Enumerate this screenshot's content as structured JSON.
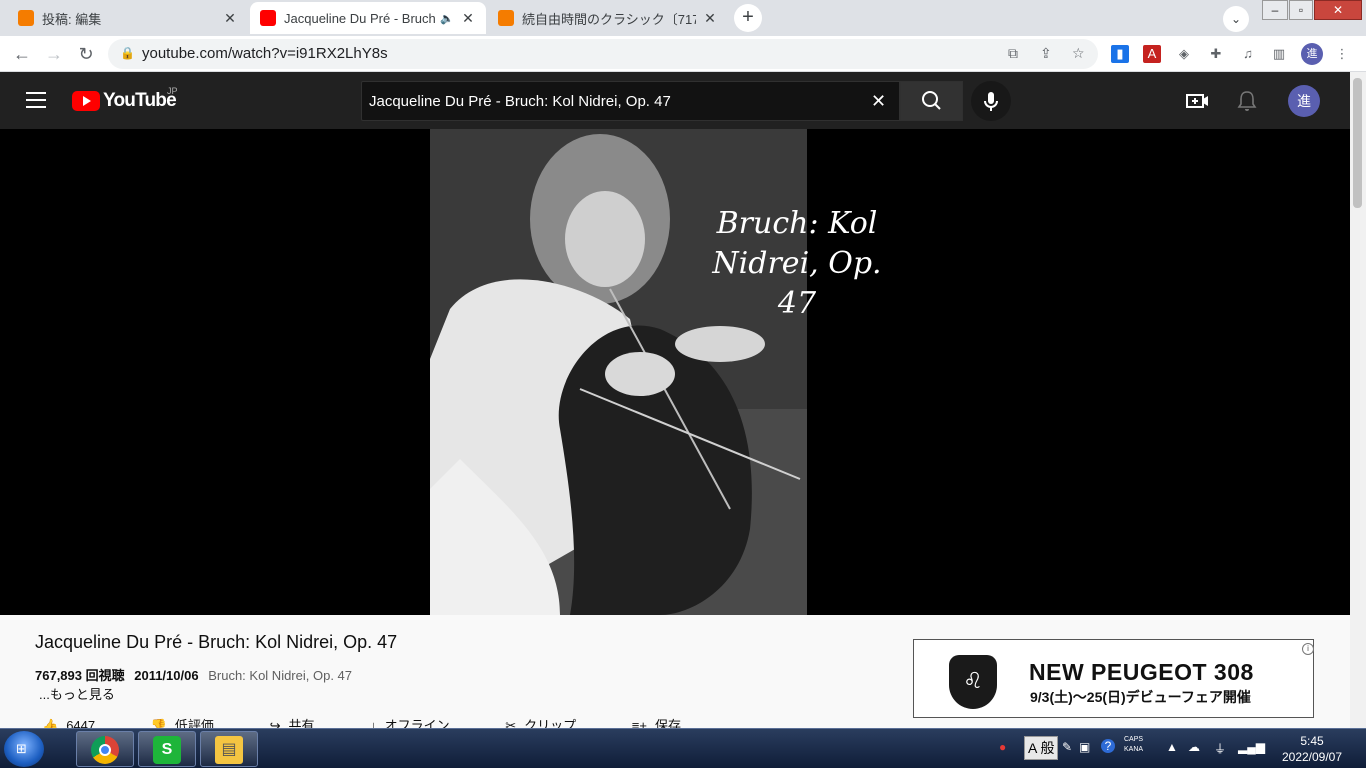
{
  "browser": {
    "tabs": [
      {
        "title": "投稿: 編集",
        "favicon_color": "#f57c00"
      },
      {
        "title": "Jacqueline Du Pré - Bruch",
        "favicon_color": "#ff0000"
      },
      {
        "title": "続自由時間のクラシック〔717〕",
        "favicon_color": "#f57c00"
      }
    ],
    "url": "youtube.com/watch?v=i91RX2LhY8s",
    "profile_initial": "進"
  },
  "youtube": {
    "logo_text": "YouTube",
    "region": "JP",
    "search_query": "Jacqueline Du Pré - Bruch: Kol Nidrei, Op. 47",
    "avatar_initial": "進",
    "video": {
      "overlay_text": "Bruch: Kol Nidrei, Op. 47",
      "title": "Jacqueline Du Pré - Bruch: Kol Nidrei, Op. 47",
      "views": "767,893 回視聴",
      "date": "2011/10/06",
      "description": "Bruch: Kol Nidrei, Op. 47",
      "more_label": "...もっと見る",
      "actions": {
        "like": "6447",
        "dislike": "低評価",
        "share": "共有",
        "offline": "オフライン",
        "clip": "クリップ",
        "save": "保存",
        "more": "..."
      }
    },
    "ad": {
      "headline": "NEW PEUGEOT 308",
      "subline": "9/3(土)～25(日)デビューフェア開催"
    }
  },
  "taskbar": {
    "ime_label": "A 般",
    "caps_line1": "CAPS",
    "caps_line2": "KANA",
    "time": "5:45",
    "date": "2022/09/07"
  }
}
